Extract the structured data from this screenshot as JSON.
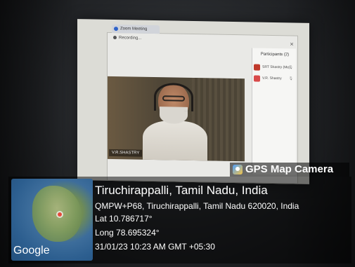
{
  "screen": {
    "tab_label": "Zoom Meeting",
    "recording_label": "Recording...",
    "speaker_name": "V.R.SHASTRY",
    "participants_title": "Participants (2)",
    "participants": [
      {
        "name": "SRT Shastry (Me)",
        "avatar_color": "#c0392b"
      },
      {
        "name": "V.R. Shastry",
        "avatar_color": "#d84a4a"
      }
    ]
  },
  "gps": {
    "badge_label": "GPS Map Camera",
    "map_label": "Google",
    "city": "Tiruchirappalli, Tamil Nadu, India",
    "address": "QMPW+P68, Tiruchirappalli, Tamil Nadu 620020, India",
    "lat": "Lat 10.786717°",
    "long": "Long 78.695324°",
    "datetime": "31/01/23 10:23 AM GMT +05:30"
  }
}
